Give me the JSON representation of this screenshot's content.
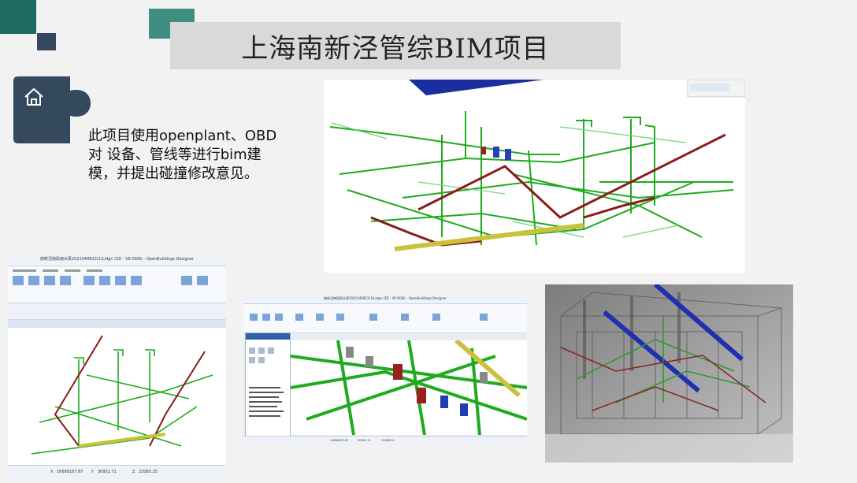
{
  "slide": {
    "title": "上海南新泾管综BIM项目",
    "description": "此项目使用openplant、OBD对 设备、管线等进行bim建模，并提出碰撞修改意见。",
    "home_icon": "home-icon"
  },
  "colors": {
    "teal_dark": "#1e6b63",
    "teal_light": "#3f8e84",
    "navy": "#34495e",
    "title_band": "#d9d9d9",
    "pipe_green": "#1faa1f",
    "pipe_red": "#8b1a1a",
    "beam_blue": "#1a2ea0"
  },
  "screenshots": [
    {
      "name": "main-3d-view"
    },
    {
      "name": "openbuildings-window-left",
      "window_title": "南新泾南段雨水泵2021040823(1)Lidgn (3D - V8 DGN) - OpenBuildings Designer",
      "coords": {
        "x": "10698167.87",
        "y": "30952.71",
        "z": "23085.25"
      }
    },
    {
      "name": "openbuildings-window-middle",
      "window_title": "南新泾南段雨水泵2021040823(1)Lidgn (3D - V8 DGN) - OpenBuildings Designer",
      "coords": {
        "x": "10698167.87",
        "y": "30952.71",
        "z": "23085.25"
      }
    },
    {
      "name": "clash-render-view"
    }
  ]
}
